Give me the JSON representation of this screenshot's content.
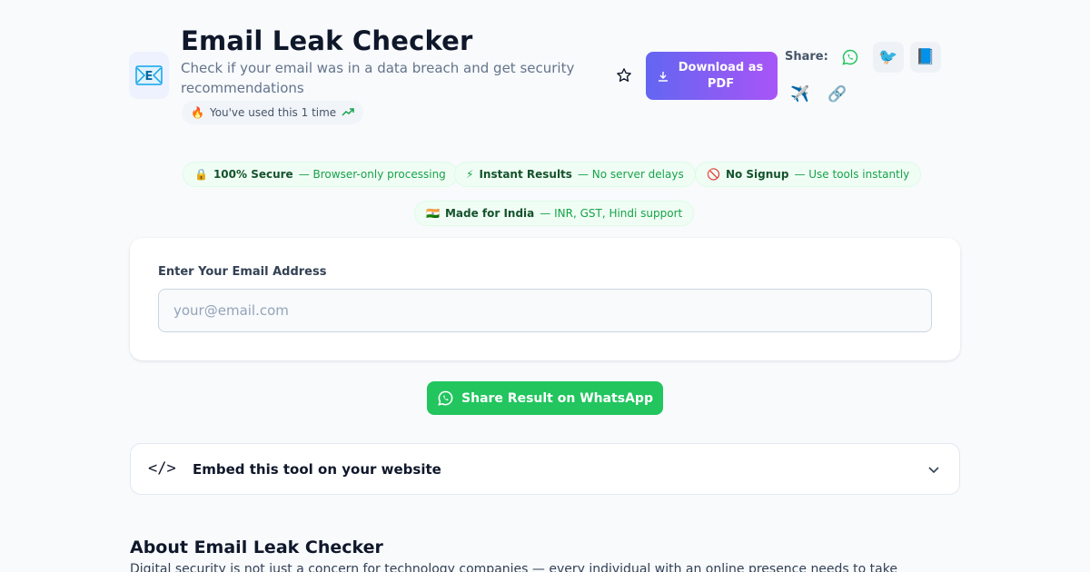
{
  "header": {
    "title": "Email Leak Checker",
    "subtitle": "Check if your email was in a data breach and get security recommendations",
    "usage_emoji": "🔥",
    "usage_text": "You've used this 1 time",
    "download_label": "Download as PDF",
    "share_label": "Share:",
    "share_icons": {
      "twitter": "🐦",
      "facebook": "📘",
      "telegram": "✈️",
      "link": "🔗"
    }
  },
  "badges": [
    {
      "icon": "🔒",
      "title": "100% Secure",
      "desc": "— Browser-only processing"
    },
    {
      "icon": "⚡",
      "title": "Instant Results",
      "desc": "— No server delays"
    },
    {
      "icon": "🚫",
      "title": "No Signup",
      "desc": "— Use tools instantly"
    },
    {
      "icon": "🇮🇳",
      "title": "Made for India",
      "desc": "— INR, GST, Hindi support"
    }
  ],
  "form": {
    "label": "Enter Your Email Address",
    "placeholder": "your@email.com",
    "value": ""
  },
  "whatsapp_button": "Share Result on WhatsApp",
  "embed": {
    "icon_text": "</>",
    "title": "Embed this tool on your website"
  },
  "about": {
    "title": "About Email Leak Checker",
    "text": "Digital security is not just a concern for technology companies — every individual with an online presence needs to take"
  },
  "colors": {
    "accent_gradient_start": "#6366f1",
    "accent_gradient_end": "#a855f7",
    "badge_green": "#16a34a",
    "whatsapp_green": "#22c55e"
  }
}
